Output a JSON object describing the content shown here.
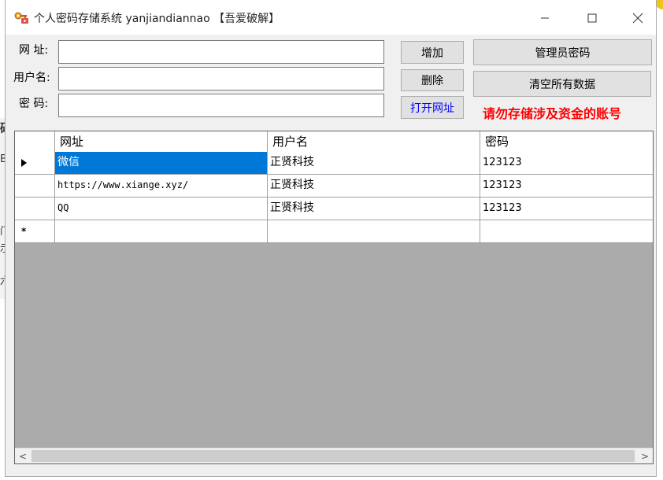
{
  "title": {
    "text": "个人密码存储系统 yanjiandiannao 【吾爱破解】"
  },
  "window_controls": {
    "minimize": "—",
    "maximize": "☐",
    "close": "✕"
  },
  "fields": [
    {
      "label": "网 址:",
      "value": ""
    },
    {
      "label": "用户名:",
      "value": ""
    },
    {
      "label": "密 码:",
      "value": ""
    }
  ],
  "buttons": {
    "add": "增加",
    "delete": "删除",
    "open_url": "打开网址",
    "admin_password": "管理员密码",
    "clear_all": "清空所有数据"
  },
  "warning": "请勿存储涉及资金的账号",
  "colors": {
    "warning": "#ff0000",
    "open_url_text": "#0000ff",
    "selection": "#0078d7",
    "grid_background": "#ababab"
  },
  "grid": {
    "columns": [
      "网址",
      "用户名",
      "密码"
    ],
    "rows": [
      {
        "marker": "current-row-arrow",
        "cells": [
          "微信",
          "正贤科技",
          "123123"
        ]
      },
      {
        "marker": "",
        "cells": [
          "https://www.xiange.xyz/",
          "正贤科技",
          "123123"
        ]
      },
      {
        "marker": "",
        "cells": [
          "QQ",
          "正贤科技",
          "123123"
        ]
      }
    ],
    "new_row_marker": "*"
  },
  "background_window_glyphs": [
    "码",
    "B",
    "门",
    "示",
    "六"
  ],
  "scrollbar": {
    "left_arrow": "<",
    "right_arrow": ">"
  }
}
